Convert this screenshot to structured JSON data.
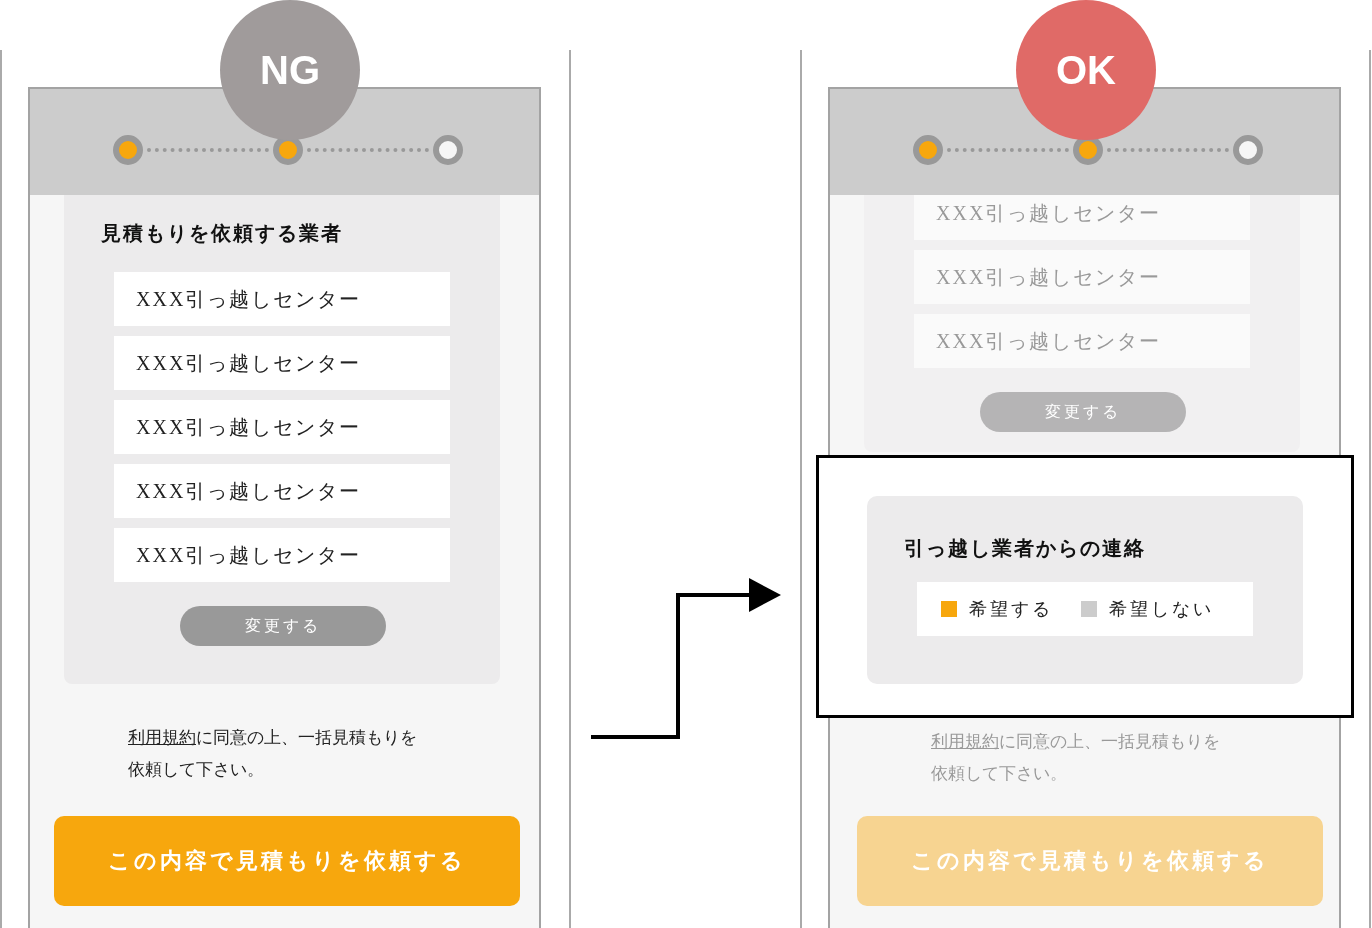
{
  "panels": [
    {
      "badge": {
        "label": "NG",
        "kind": "ng"
      },
      "dimmed": false,
      "steps": [
        {
          "filled": true
        },
        {
          "filled": true
        },
        {
          "filled": false
        }
      ],
      "vendor_section": {
        "title": "見積もりを依頼する業者",
        "vendors": [
          "XXX引っ越しセンター",
          "XXX引っ越しセンター",
          "XXX引っ越しセンター",
          "XXX引っ越しセンター",
          "XXX引っ越しセンター"
        ],
        "change_button": "変更する"
      },
      "terms": {
        "link": "利用規約",
        "text": "に同意の上、一括見積もりを依頼して下さい。"
      },
      "submit_button": "この内容で見積もりを依頼する"
    },
    {
      "badge": {
        "label": "OK",
        "kind": "ok"
      },
      "dimmed": true,
      "steps": [
        {
          "filled": true
        },
        {
          "filled": true
        },
        {
          "filled": false
        }
      ],
      "vendor_section": {
        "vendors": [
          "XXX引っ越しセンター",
          "XXX引っ越しセンター",
          "XXX引っ越しセンター"
        ],
        "change_button": "変更する"
      },
      "contact_section": {
        "title": "引っ越し業者からの連絡",
        "options": [
          {
            "label": "希望する",
            "selected": true
          },
          {
            "label": "希望しない",
            "selected": false
          }
        ]
      },
      "terms": {
        "link": "利用規約",
        "text": "に同意の上、一括見積もりを依頼して下さい。"
      },
      "submit_button": "この内容で見積もりを依頼する"
    }
  ]
}
